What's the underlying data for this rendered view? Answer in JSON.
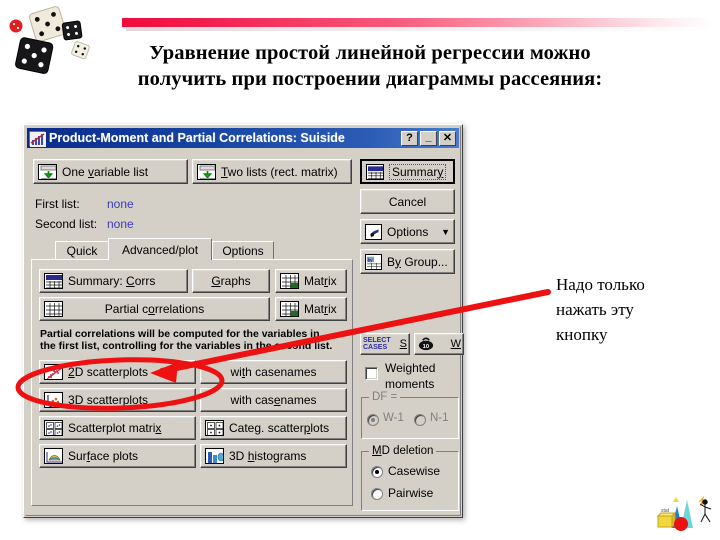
{
  "slide": {
    "title_line1": "Уравнение простой линейной регрессии можно",
    "title_line2": "получить при построении диаграммы рассеяния:",
    "accent_color": "#f21e4e",
    "annotation_color": "#ee1111"
  },
  "annotation": {
    "line1": "Надо только",
    "line2": "нажать эту",
    "line3": "кнопку"
  },
  "dialog": {
    "title": "Product-Moment and Partial Correlations: Suiside",
    "window_buttons": [
      {
        "name": "help",
        "glyph": "?"
      },
      {
        "name": "minimize",
        "glyph": "_"
      },
      {
        "name": "close",
        "glyph": "✕"
      }
    ],
    "top_buttons": [
      {
        "label": "One variable list",
        "accel": "v"
      },
      {
        "label": "Two lists (rect. matrix)",
        "accel": "T"
      }
    ],
    "lists": [
      {
        "label": "First list:",
        "value": "none"
      },
      {
        "label": "Second list:",
        "value": "none"
      }
    ],
    "tabs": [
      {
        "label": "Quick",
        "active": false
      },
      {
        "label": "Advanced/plot",
        "active": true
      },
      {
        "label": "Options",
        "active": false
      }
    ],
    "advanced_buttons": [
      {
        "label": "Summary: Corrs",
        "icon": "summary-grid-icon"
      },
      {
        "label": "Graphs",
        "icon": "none"
      },
      {
        "label": "Matrix",
        "icon": "matrix-icon"
      },
      {
        "label": "Partial correlations",
        "icon": "grid-icon"
      },
      {
        "label": "Matrix",
        "icon": "matrix-icon"
      }
    ],
    "help_text_line1": "Partial correlations will be computed for the variables in",
    "help_text_line2": "the first list, controlling for the variables in the second list.",
    "plot_buttons": [
      {
        "label": "2D scatterplots",
        "icon": "scatter2d-icon",
        "highlighted": true
      },
      {
        "label": "with casenames",
        "icon": "none",
        "highlighted": false
      },
      {
        "label": "3D scatterplots",
        "icon": "scatter3d-icon",
        "highlighted": false
      },
      {
        "label": "with casenames",
        "icon": "none",
        "highlighted": false
      },
      {
        "label": "Scatterplot matrix",
        "icon": "scatter-matrix-icon",
        "highlighted": false
      },
      {
        "label": "Categ. scatterplots",
        "icon": "categ-scatter-icon",
        "highlighted": false
      },
      {
        "label": "Surface plots",
        "icon": "surface-icon",
        "highlighted": false
      },
      {
        "label": "3D histograms",
        "icon": "histogram3d-icon",
        "highlighted": false
      }
    ],
    "side_buttons": [
      {
        "label": "Summary",
        "icon": "summary-grid-icon",
        "default": true
      },
      {
        "label": "Cancel",
        "icon": "none",
        "default": false
      },
      {
        "label": "Options",
        "icon": "options-icon",
        "dropdown": true
      },
      {
        "label": "By Group...",
        "icon": "by-group-icon",
        "dropdown": false
      }
    ],
    "select_bar": {
      "select_cases_top": "SELECT",
      "select_cases_bottom": "CASES",
      "select_accel": "S",
      "weight_accel": "W"
    },
    "weighted_moments": {
      "label_line1": "Weighted",
      "label_line2": "moments",
      "checked": false
    },
    "df_group": {
      "title": "DF =",
      "enabled": false,
      "options": [
        {
          "label": "W-1",
          "selected": true
        },
        {
          "label": "N-1",
          "selected": false
        }
      ]
    },
    "md_group": {
      "title": "MD deletion",
      "options": [
        {
          "label": "Casewise",
          "selected": true
        },
        {
          "label": "Pairwise",
          "selected": false
        }
      ]
    }
  }
}
